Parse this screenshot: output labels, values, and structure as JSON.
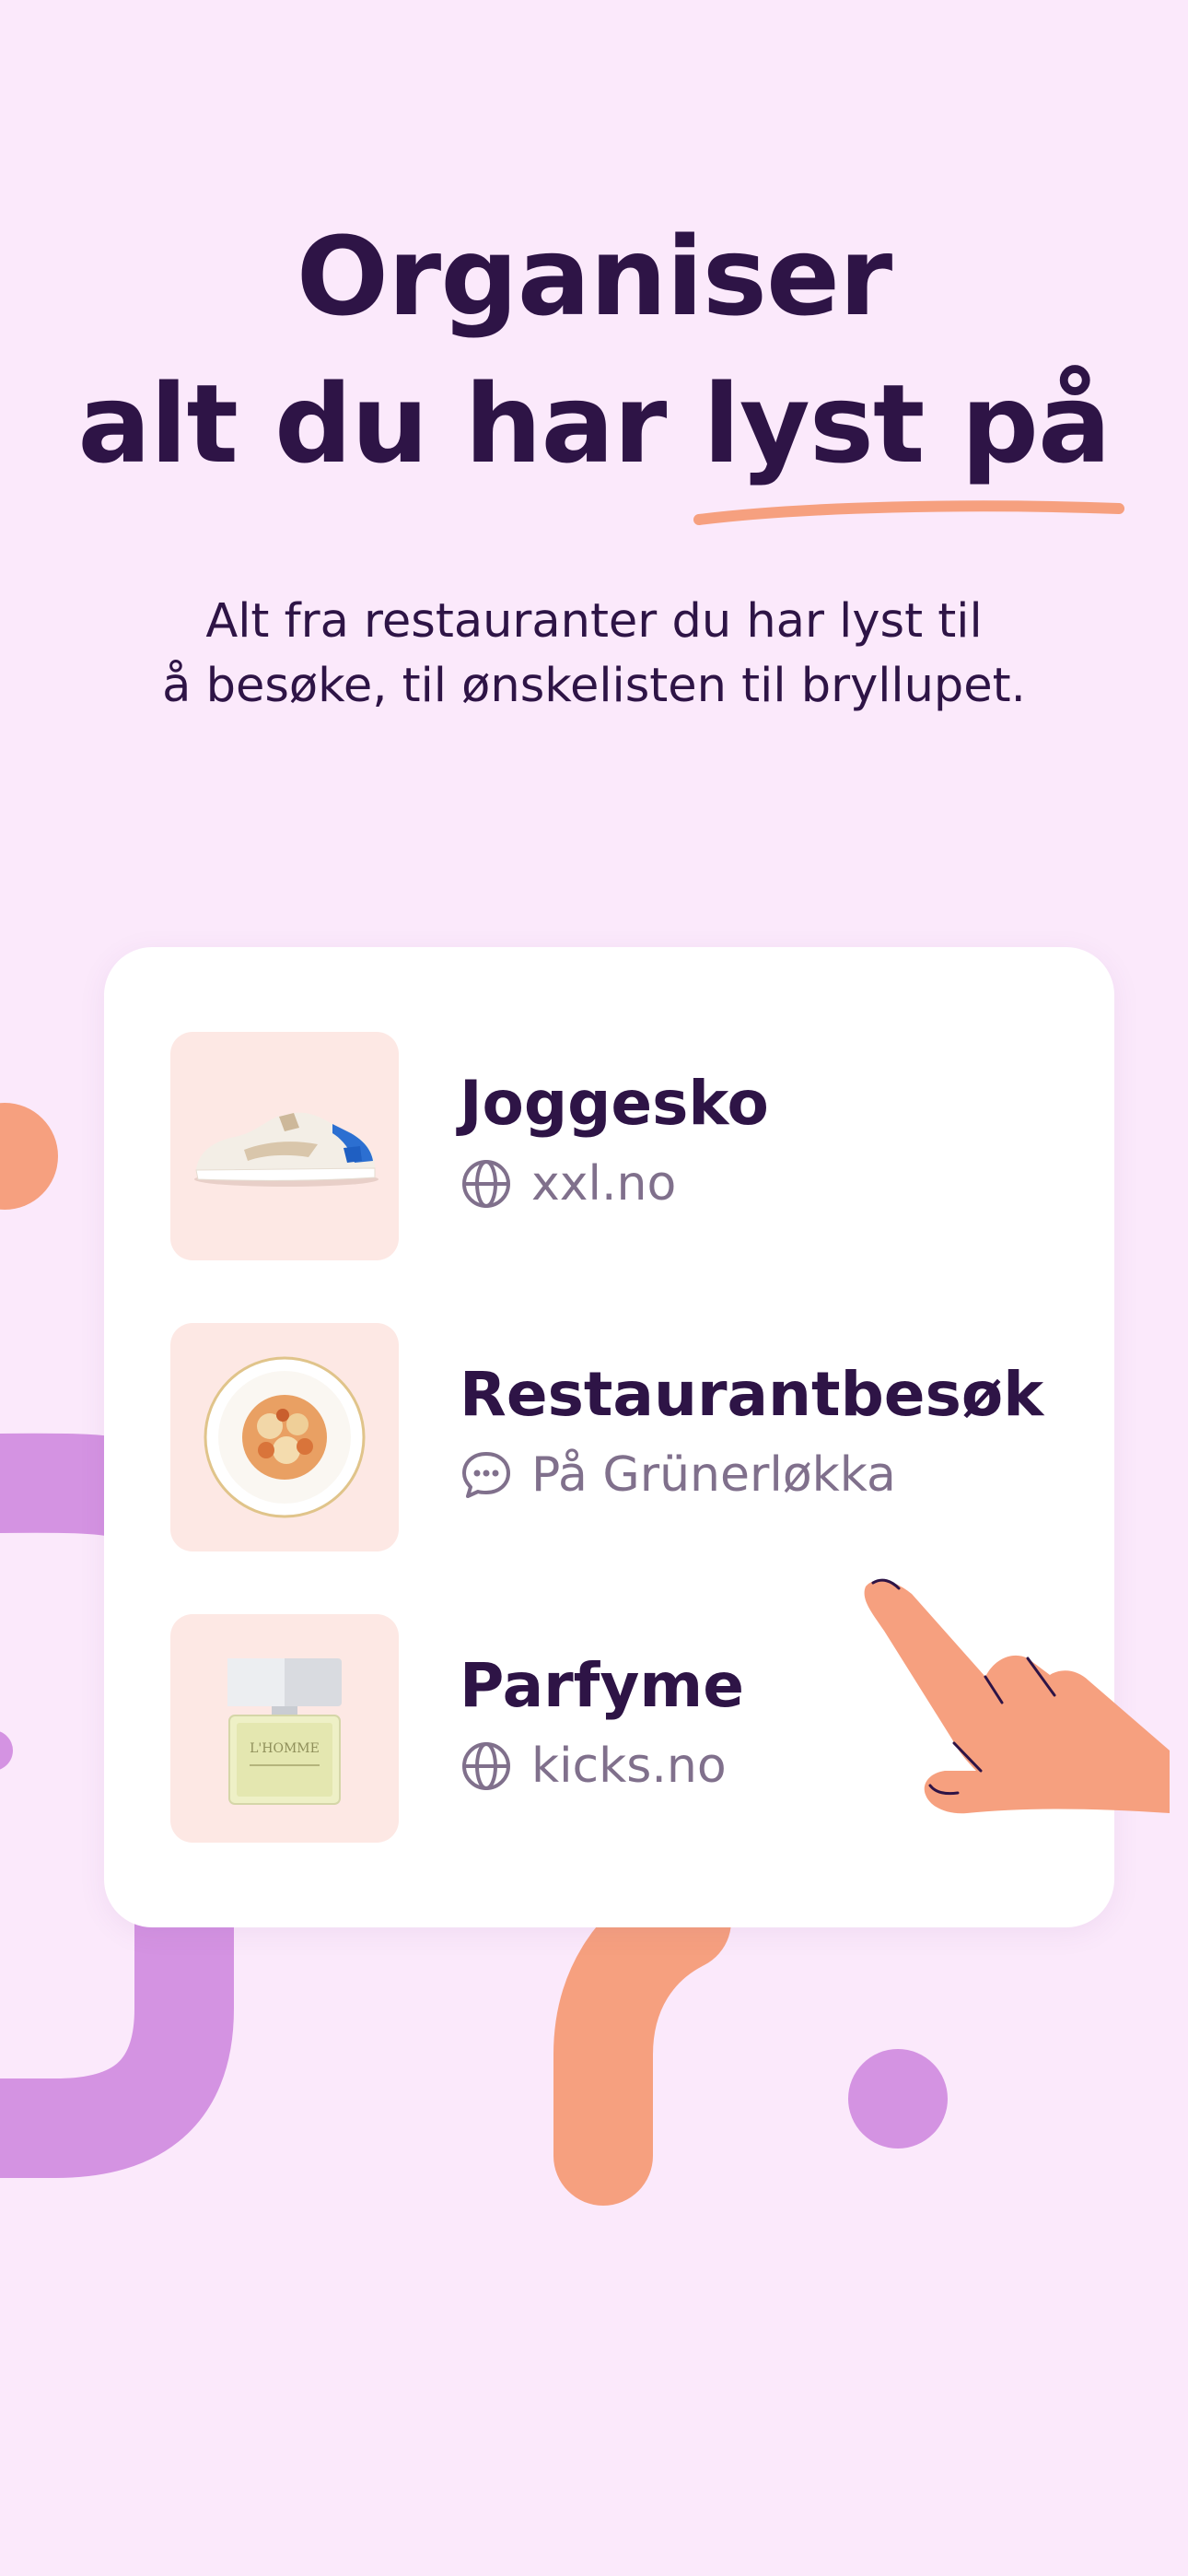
{
  "headline": {
    "line1": "Organiser",
    "line2_prefix": "alt du har ",
    "line2_highlight": "lyst på",
    "accent_color": "#f6a07f"
  },
  "subtitle": {
    "line1": "Alt fra restauranter du har lyst til",
    "line2": "å besøke, til ønskelisten til bryllupet."
  },
  "items": [
    {
      "title": "Joggesko",
      "subtitle": "xxl.no",
      "icon": "globe-icon",
      "image": "sneaker"
    },
    {
      "title": "Restaurantbesøk",
      "subtitle": "På Grünerløkka",
      "icon": "chat-bubble-icon",
      "image": "pasta-plate"
    },
    {
      "title": "Parfyme",
      "subtitle": "kicks.no",
      "icon": "globe-icon",
      "image": "perfume-bottle"
    }
  ],
  "perfume_label": "L'HOMME",
  "colors": {
    "background": "#fbe9fb",
    "text": "#2e1446",
    "muted": "#80708c",
    "orange": "#f6a07f",
    "purple": "#d493e2"
  }
}
